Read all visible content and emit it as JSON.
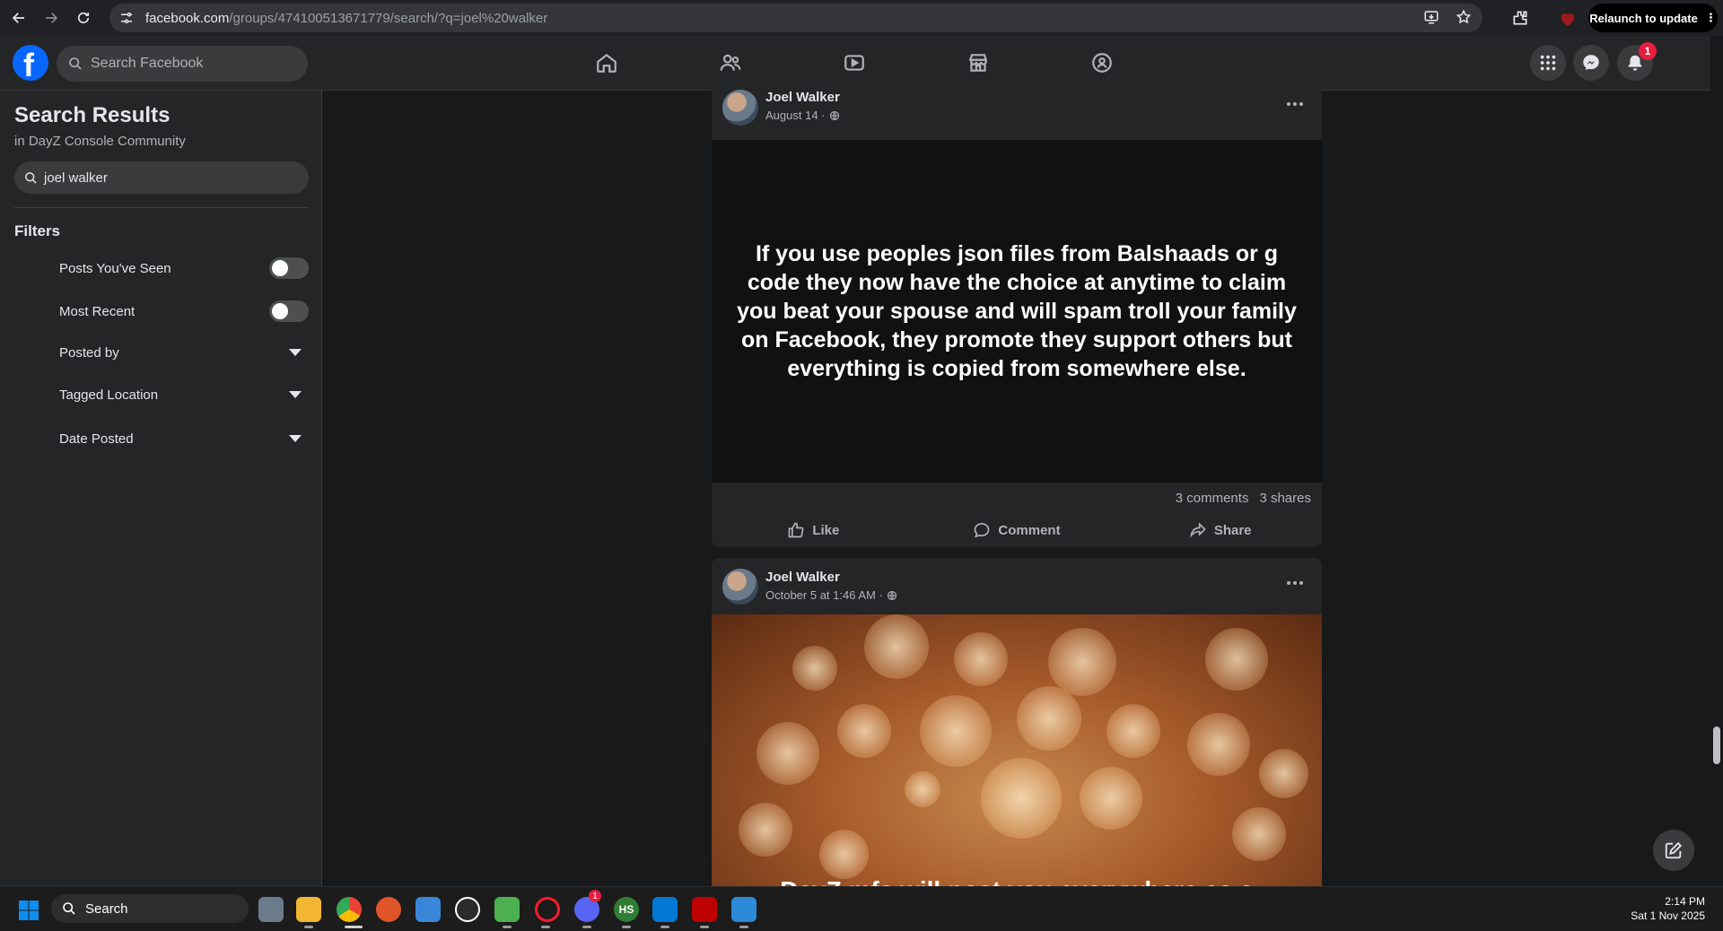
{
  "browser": {
    "url_host": "facebook.com",
    "url_path": "/groups/474100513671779/search/?q=joel%20walker",
    "relaunch_label": "Relaunch to update"
  },
  "header": {
    "search_placeholder": "Search Facebook",
    "notification_count": "1"
  },
  "sidebar": {
    "title": "Search Results",
    "subtitle": "in DayZ Console Community",
    "search_value": "joel walker",
    "filters_heading": "Filters",
    "filters": [
      {
        "label": "Posts You've Seen",
        "type": "toggle",
        "on": false
      },
      {
        "label": "Most Recent",
        "type": "toggle",
        "on": false
      },
      {
        "label": "Posted by",
        "type": "dropdown"
      },
      {
        "label": "Tagged Location",
        "type": "dropdown"
      },
      {
        "label": "Date Posted",
        "type": "dropdown"
      }
    ]
  },
  "posts": [
    {
      "author": "Joel Walker",
      "date": "August 14 ·",
      "text": "If you use peoples json files from Balshaads or g code they now have the choice at anytime to claim you beat your spouse and will spam troll your family on Facebook, they promote they support others but everything is copied from somewhere else.",
      "comments": "3 comments",
      "shares": "3 shares",
      "actions": {
        "like": "Like",
        "comment": "Comment",
        "share": "Share"
      }
    },
    {
      "author": "Joel Walker",
      "date": "October 5 at 1:46 AM ·",
      "text": "DayZ mfs will post you everywhere as a"
    }
  ],
  "taskbar": {
    "search_label": "Search",
    "discord_badge": "1",
    "time": "2:14 PM",
    "date": "Sat 1 Nov 2025"
  }
}
